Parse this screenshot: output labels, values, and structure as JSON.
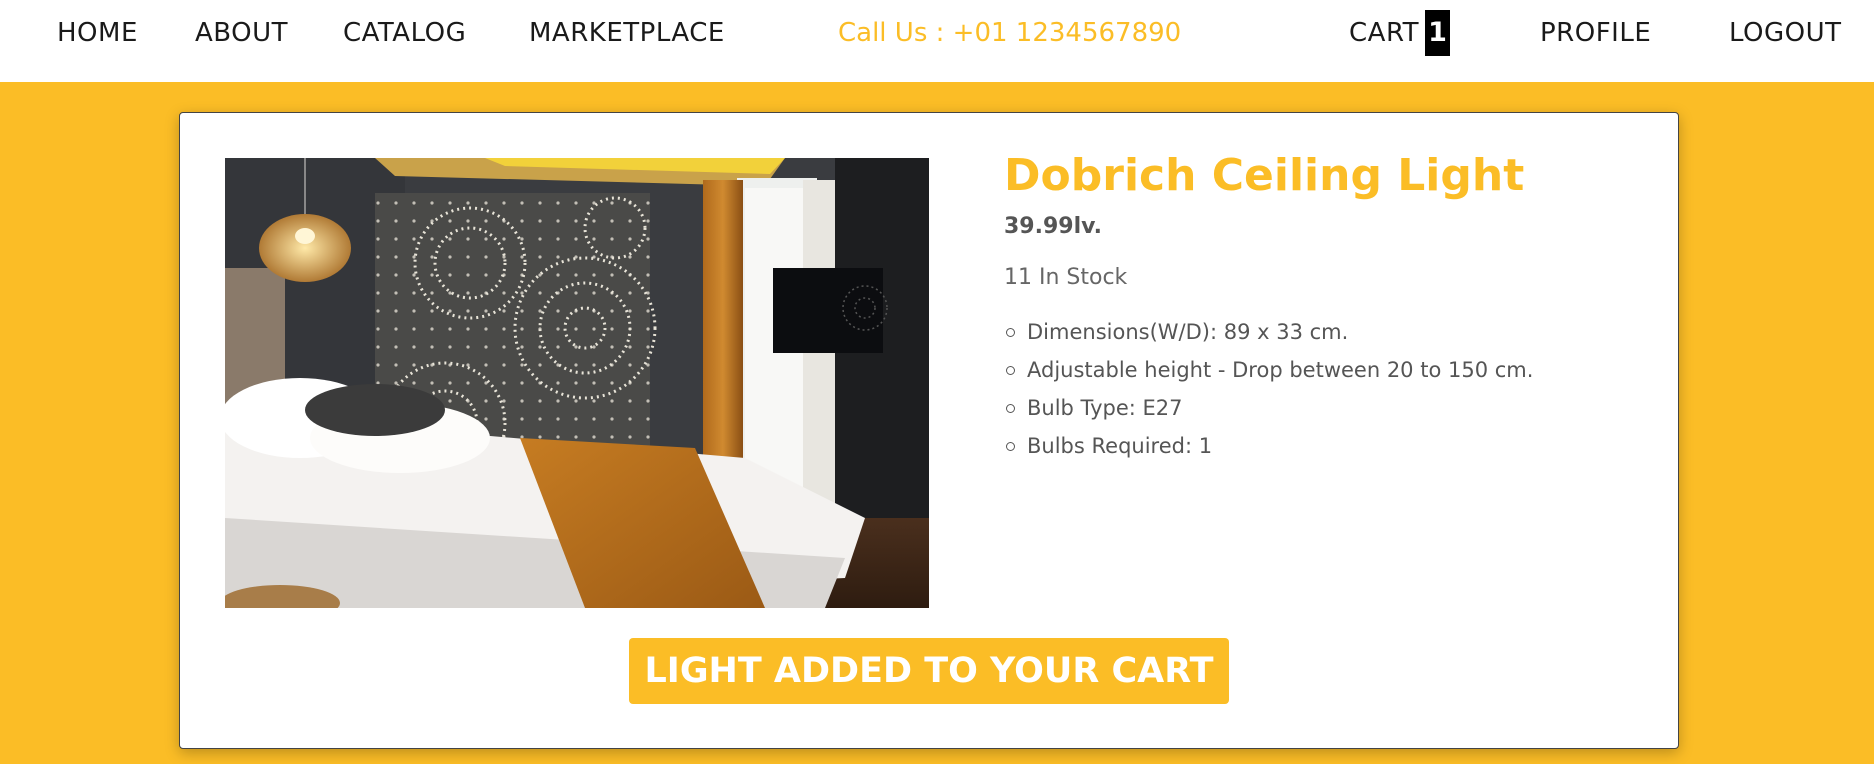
{
  "nav": {
    "home": "HOME",
    "about": "ABOUT",
    "catalog": "CATALOG",
    "marketplace": "MARKETPLACE",
    "phone": "Call Us : +01 1234567890",
    "cart": "CART",
    "cart_count": "1",
    "profile": "PROFILE",
    "logout": "LOGOUT"
  },
  "product": {
    "title": "Dobrich Ceiling Light",
    "price": "39.99lv.",
    "stock": "11 In Stock",
    "specs": [
      "Dimensions(W/D): 89 x 33 cm.",
      "Adjustable height - Drop between 20 to 150 cm.",
      "Bulb Type: E27",
      "Bulbs Required: 1"
    ],
    "button_label": "LIGHT ADDED TO YOUR CART",
    "image_icon": "bedroom-photo"
  },
  "colors": {
    "accent": "#fbbd26",
    "text": "#1a1a1a",
    "muted": "#555555"
  }
}
